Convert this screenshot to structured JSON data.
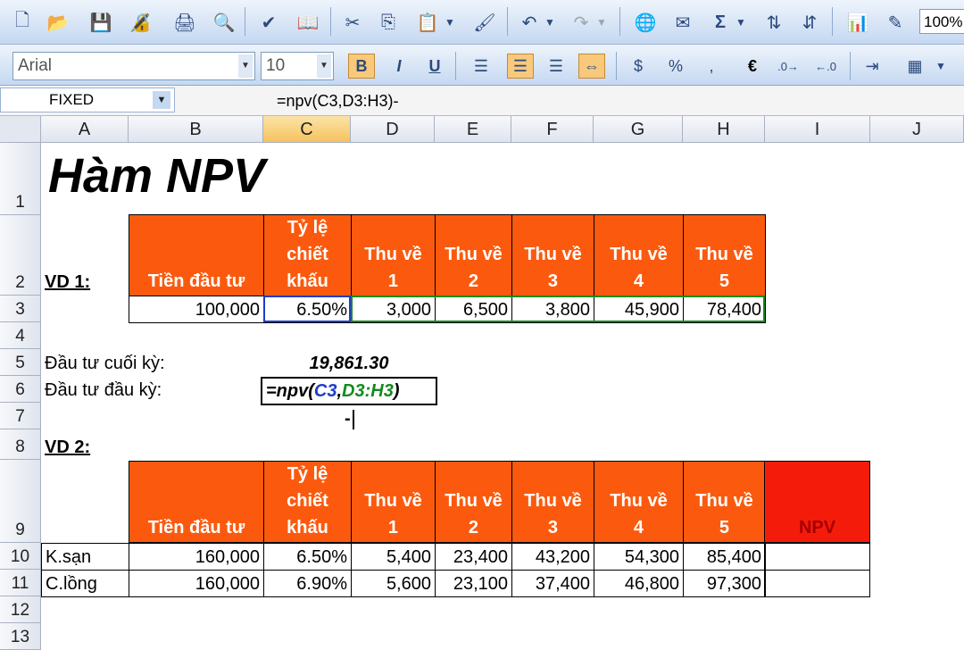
{
  "toolbar": {
    "zoom": "100%",
    "sum_glyph": "Σ",
    "euro_glyph": "€",
    "dollar_glyph": "$",
    "percent_glyph": "%",
    "comma_glyph": ","
  },
  "format_bar": {
    "font_name": "Arial",
    "font_size": "10",
    "bold": "B",
    "italic": "I",
    "underline": "U"
  },
  "formula_bar": {
    "name_box": "FIXED",
    "formula": "=npv(C3,D3:H3)-"
  },
  "columns": [
    "A",
    "B",
    "C",
    "D",
    "E",
    "F",
    "G",
    "H",
    "I",
    "J"
  ],
  "rows": [
    "1",
    "2",
    "3",
    "4",
    "5",
    "6",
    "7",
    "8",
    "9",
    "10",
    "11",
    "12",
    "13"
  ],
  "sheet": {
    "title": "Hàm NPV",
    "vd1_label": "VD 1:",
    "vd2_label": "VD 2:",
    "headers": [
      [
        "Tiền đầu tư"
      ],
      [
        "Tỷ lệ",
        "chiết",
        "khấu"
      ],
      [
        "Thu về",
        "1"
      ],
      [
        "Thu về",
        "2"
      ],
      [
        "Thu về",
        "3"
      ],
      [
        "Thu về",
        "4"
      ],
      [
        "Thu về",
        "5"
      ]
    ],
    "npv_header": "NPV",
    "row3": [
      "100,000",
      "6.50%",
      "3,000",
      "6,500",
      "3,800",
      "45,900",
      "78,400"
    ],
    "end_label": "Đầu tư cuối kỳ:",
    "end_value": "19,861.30",
    "begin_label": "Đầu tư đầu kỳ:",
    "edit_fn": "=npv(",
    "edit_ref1": "C3",
    "edit_comma": ",",
    "edit_ref2": "D3:H3",
    "edit_close": ")",
    "row7_text": "-",
    "row10_label": "K.sạn",
    "row10": [
      "160,000",
      "6.50%",
      "5,400",
      "23,400",
      "43,200",
      "54,300",
      "85,400"
    ],
    "row11_label": "C.lồng",
    "row11": [
      "160,000",
      "6.90%",
      "5,600",
      "23,100",
      "37,400",
      "46,800",
      "97,300"
    ]
  }
}
